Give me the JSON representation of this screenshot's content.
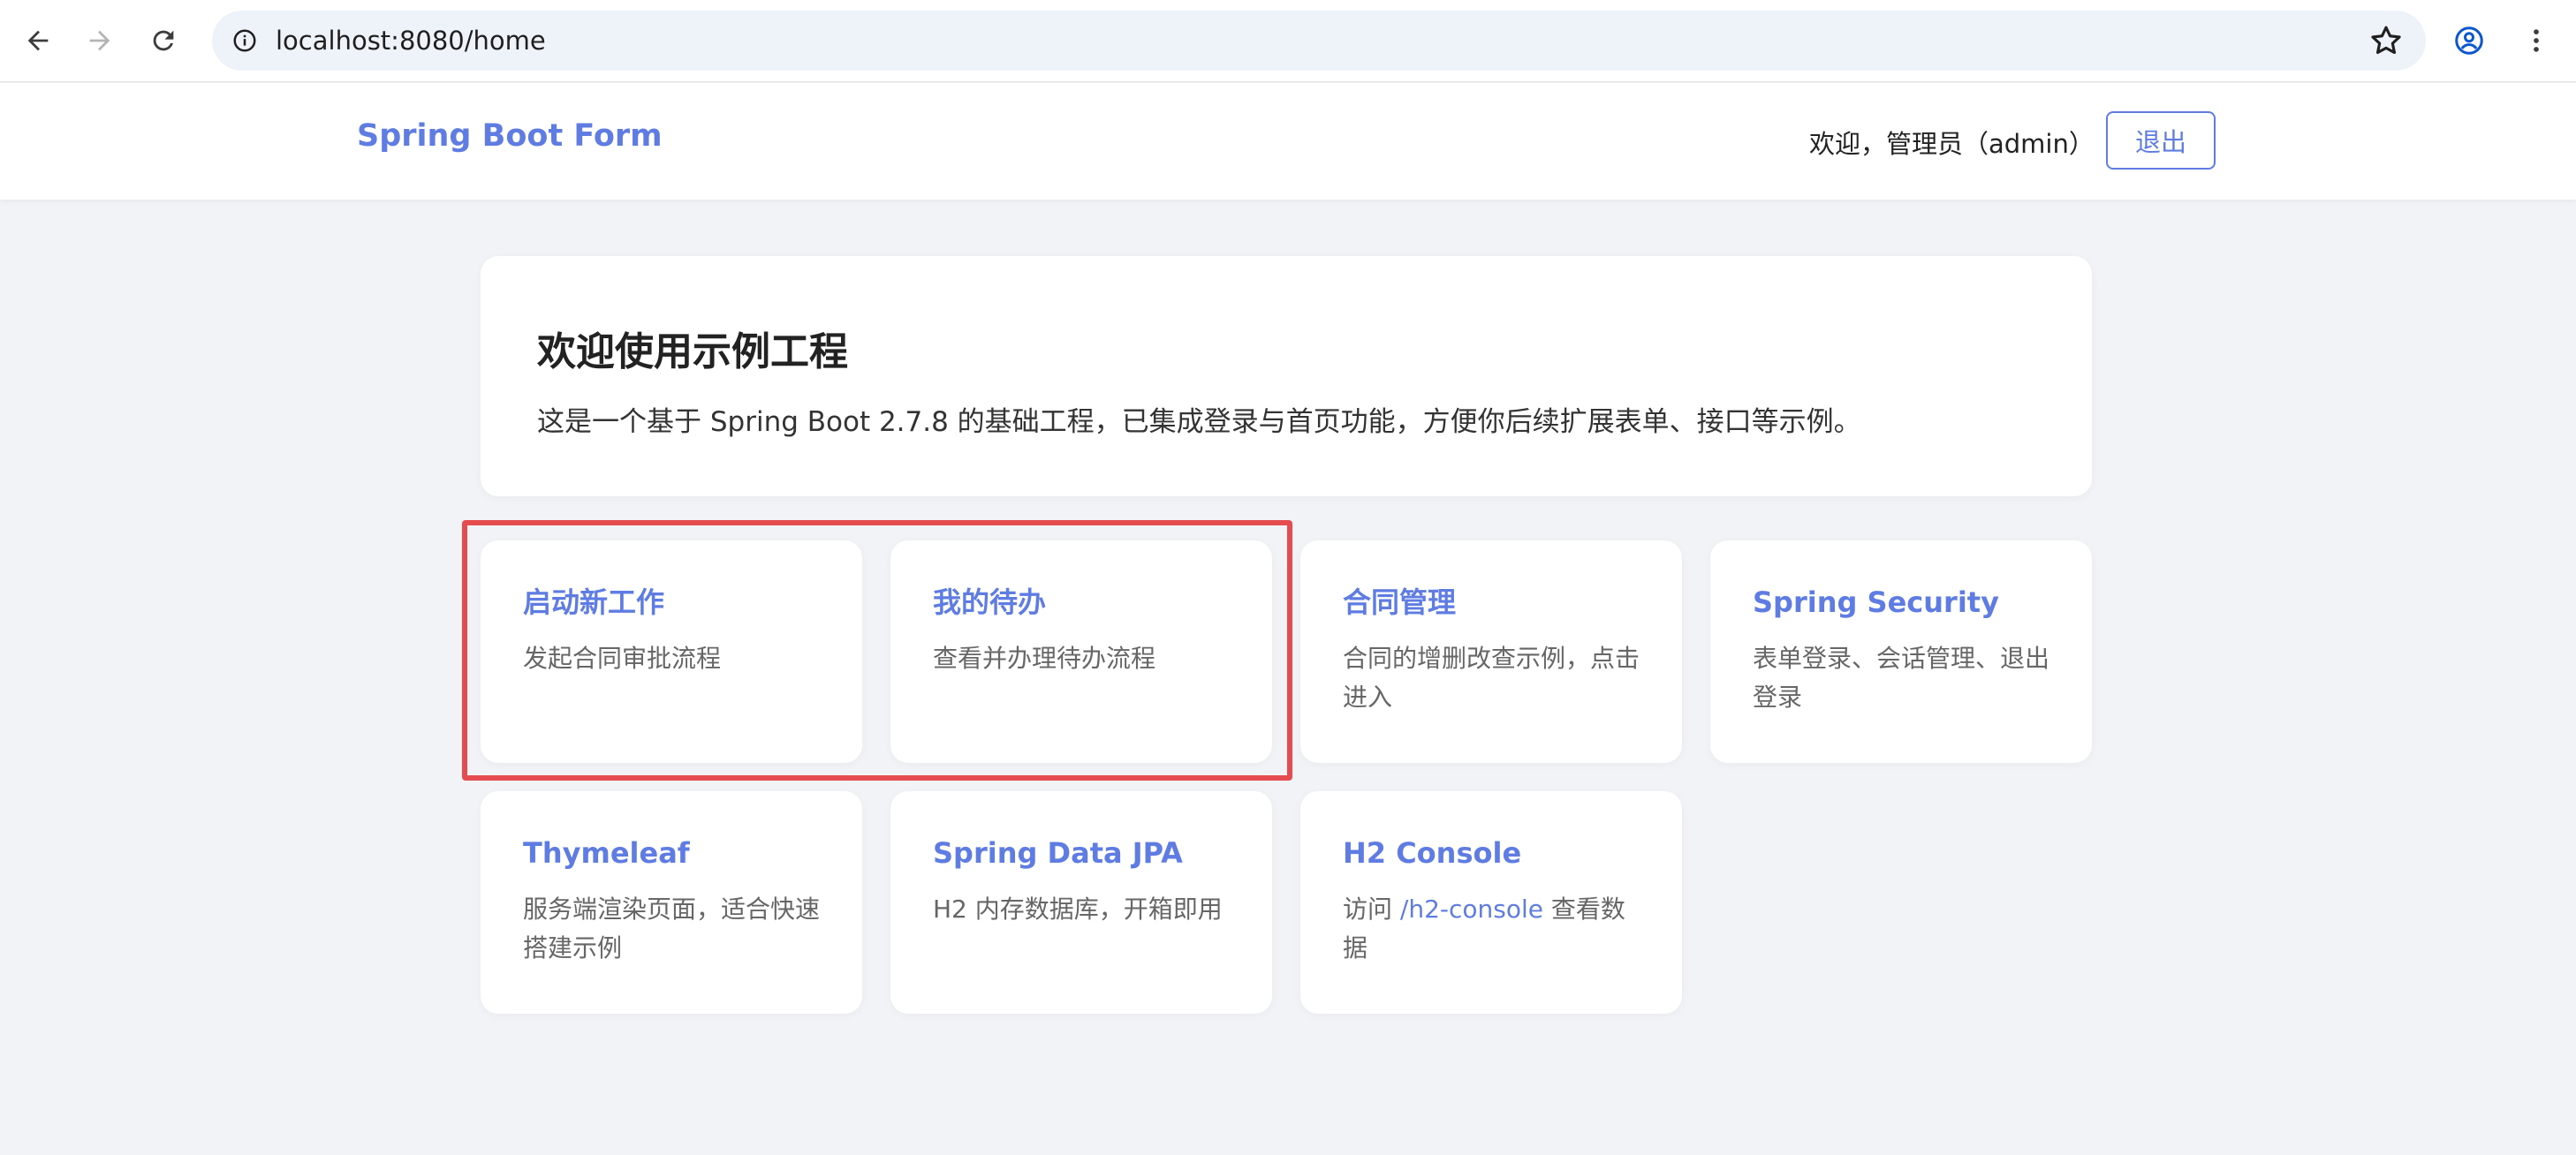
{
  "browser": {
    "url": "localhost:8080/home"
  },
  "header": {
    "brand": "Spring Boot Form",
    "welcome": "欢迎，管理员（admin）",
    "logout_label": "退出"
  },
  "intro": {
    "title": "欢迎使用示例工程",
    "description": "这是一个基于 Spring Boot 2.7.8 的基础工程，已集成登录与首页功能，方便你后续扩展表单、接口等示例。"
  },
  "cards": [
    {
      "title": "启动新工作",
      "desc": "发起合同审批流程"
    },
    {
      "title": "我的待办",
      "desc": "查看并办理待办流程"
    },
    {
      "title": "合同管理",
      "desc": "合同的增删改查示例，点击进入"
    },
    {
      "title": "Spring Security",
      "desc": "表单登录、会话管理、退出登录"
    },
    {
      "title": "Thymeleaf",
      "desc": "服务端渲染页面，适合快速搭建示例"
    },
    {
      "title": "Spring Data JPA",
      "desc": "H2 内存数据库，开箱即用"
    },
    {
      "title": "H2 Console",
      "desc_prefix": "访问 ",
      "desc_link": "/h2-console",
      "desc_suffix": " 查看数据"
    }
  ],
  "colors": {
    "accent": "#5e7ce2",
    "highlight": "#e54c4f"
  }
}
